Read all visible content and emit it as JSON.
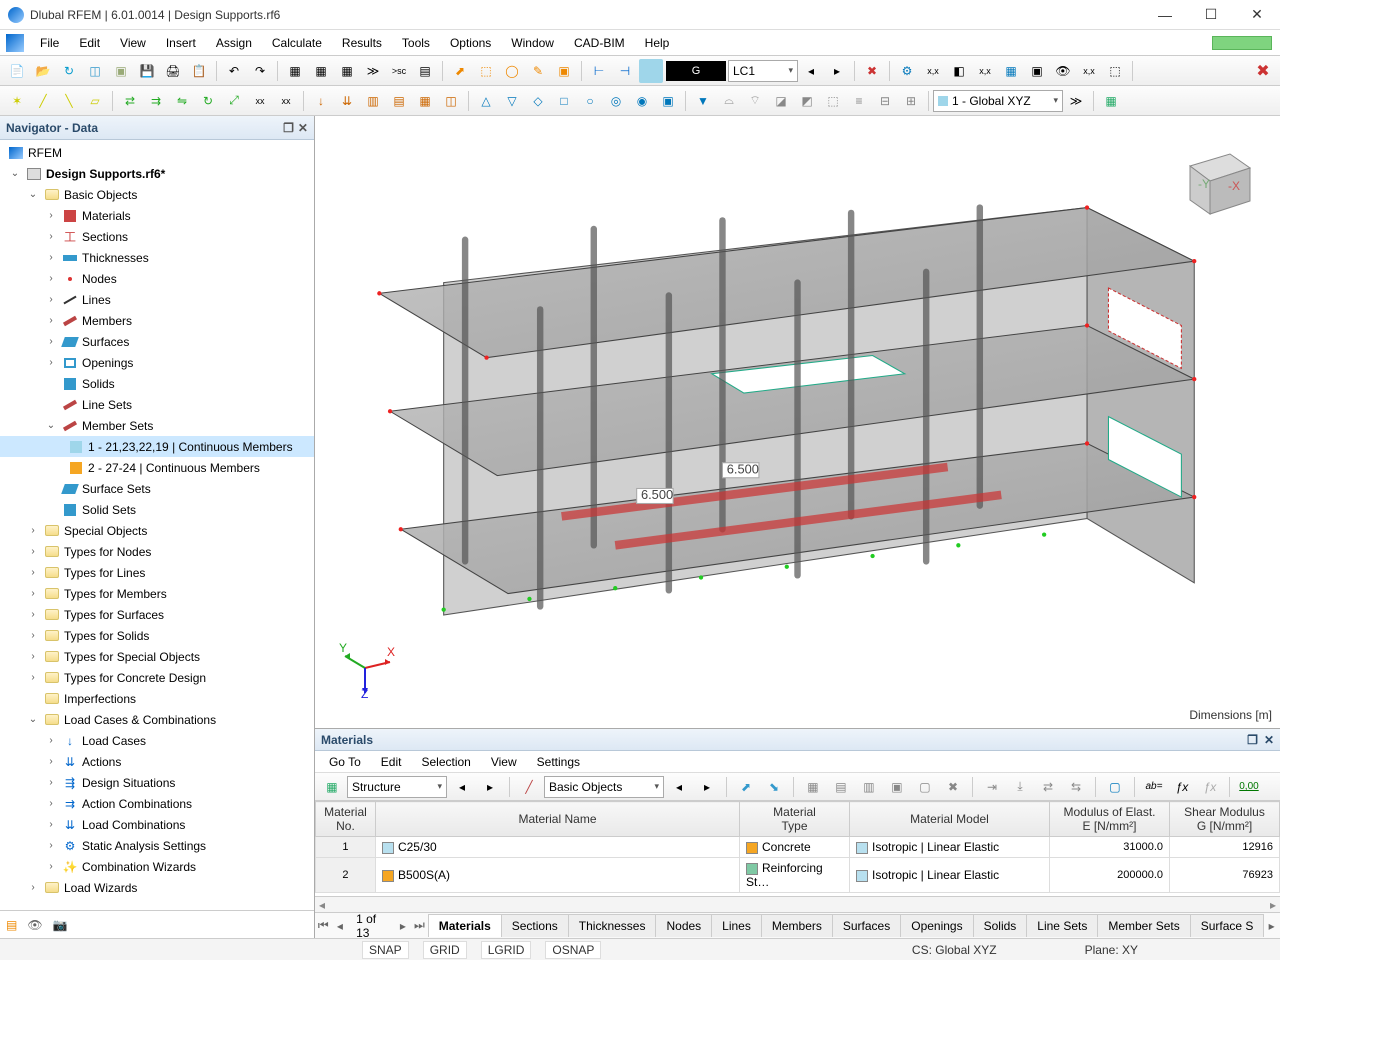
{
  "titlebar": {
    "text": "Dlubal RFEM | 6.01.0014 | Design Supports.rf6"
  },
  "menus": [
    "File",
    "Edit",
    "View",
    "Insert",
    "Assign",
    "Calculate",
    "Results",
    "Tools",
    "Options",
    "Window",
    "CAD-BIM",
    "Help"
  ],
  "toolbar2_combo": "1 - Global XYZ",
  "lc_label": "LC1",
  "lc_box": "G",
  "navigator": {
    "title": "Navigator - Data",
    "root": "RFEM",
    "project": "Design Supports.rf6*",
    "basic_objects_label": "Basic Objects",
    "basic_objects": [
      "Materials",
      "Sections",
      "Thicknesses",
      "Nodes",
      "Lines",
      "Members",
      "Surfaces",
      "Openings",
      "Solids",
      "Line Sets",
      "Member Sets"
    ],
    "member_sets": [
      {
        "label": "1 - 21,23,22,19 | Continuous Members",
        "selected": true,
        "color": "#9fd6ea"
      },
      {
        "label": "2 - 27-24 | Continuous Members",
        "selected": false,
        "color": "#f5a623"
      }
    ],
    "after_member_sets": [
      "Surface Sets",
      "Solid Sets"
    ],
    "folders": [
      "Special Objects",
      "Types for Nodes",
      "Types for Lines",
      "Types for Members",
      "Types for Surfaces",
      "Types for Solids",
      "Types for Special Objects",
      "Types for Concrete Design",
      "Imperfections",
      "Load Cases & Combinations"
    ],
    "lcc_children": [
      "Load Cases",
      "Actions",
      "Design Situations",
      "Action Combinations",
      "Load Combinations",
      "Static Analysis Settings",
      "Combination Wizards"
    ],
    "last_folder": "Load Wizards"
  },
  "viewport": {
    "dim_label": "Dimensions [m]"
  },
  "materials": {
    "title": "Materials",
    "menu": [
      "Go To",
      "Edit",
      "Selection",
      "View",
      "Settings"
    ],
    "filter1": "Structure",
    "filter2": "Basic Objects",
    "columns": [
      "Material\nNo.",
      "Material Name",
      "Material\nType",
      "Material Model",
      "Modulus of Elast.\nE [N/mm²]",
      "Shear Modulus\nG [N/mm²]"
    ],
    "rows": [
      {
        "no": "1",
        "swatch": "#b8e0ef",
        "name": "C25/30",
        "type_swatch": "#f5a623",
        "type": "Concrete",
        "model_swatch": "#b8e0ef",
        "model": "Isotropic | Linear Elastic",
        "e": "31000.0",
        "g": "12916"
      },
      {
        "no": "2",
        "swatch": "#f5a623",
        "name": "B500S(A)",
        "type_swatch": "#7fc9a4",
        "type": "Reinforcing St…",
        "model_swatch": "#b8e0ef",
        "model": "Isotropic | Linear Elastic",
        "e": "200000.0",
        "g": "76923"
      }
    ],
    "page": "1 of 13",
    "tabs": [
      "Materials",
      "Sections",
      "Thicknesses",
      "Nodes",
      "Lines",
      "Members",
      "Surfaces",
      "Openings",
      "Solids",
      "Line Sets",
      "Member Sets",
      "Surface S"
    ]
  },
  "status": {
    "snap": "SNAP",
    "grid": "GRID",
    "lgrid": "LGRID",
    "osnap": "OSNAP",
    "cs": "CS: Global XYZ",
    "plane": "Plane: XY"
  }
}
